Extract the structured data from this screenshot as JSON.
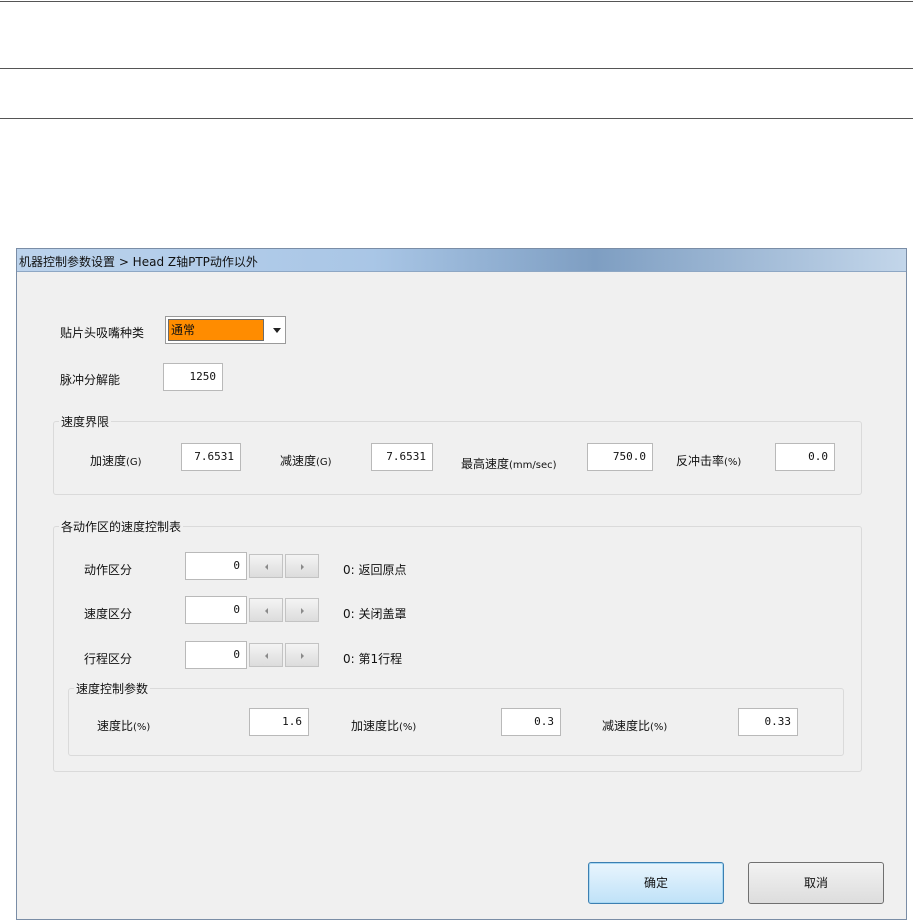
{
  "window": {
    "title": "机器控制参数设置 > Head Z轴PTP动作以外"
  },
  "nozzle_type": {
    "label": "贴片头吸嘴种类",
    "value": "通常"
  },
  "pulse_resolution": {
    "label": "脉冲分解能",
    "value": "1250"
  },
  "speed_limit": {
    "title": "速度界限",
    "accel": {
      "label": "加速度",
      "unit": "(G)",
      "value": "7.6531"
    },
    "decel": {
      "label": "减速度",
      "unit": "(G)",
      "value": "7.6531"
    },
    "max_speed": {
      "label": "最高速度",
      "unit": "(mm/sec)",
      "value": "750.0"
    },
    "recoil": {
      "label": "反冲击率",
      "unit": "(%)",
      "value": "0.0"
    }
  },
  "speed_table": {
    "title": "各动作区的速度控制表",
    "rows": [
      {
        "label": "动作区分",
        "value": "0",
        "desc": "0: 返回原点"
      },
      {
        "label": "速度区分",
        "value": "0",
        "desc": "0: 关闭盖罩"
      },
      {
        "label": "行程区分",
        "value": "0",
        "desc": "0: 第1行程"
      }
    ],
    "params": {
      "title": "速度控制参数",
      "speed_ratio": {
        "label": "速度比",
        "unit": "(%)",
        "value": "1.6"
      },
      "accel_ratio": {
        "label": "加速度比",
        "unit": "(%)",
        "value": "0.3"
      },
      "decel_ratio": {
        "label": "减速度比",
        "unit": "(%)",
        "value": "0.33"
      }
    }
  },
  "buttons": {
    "ok": "确定",
    "cancel": "取消"
  },
  "colors": {
    "selected_highlight": "#ff8c00",
    "ok_border": "#3c7fb1"
  },
  "icons": {
    "dropdown": "chevron-down-icon",
    "spin_left": "arrow-left-icon",
    "spin_right": "arrow-right-icon"
  }
}
